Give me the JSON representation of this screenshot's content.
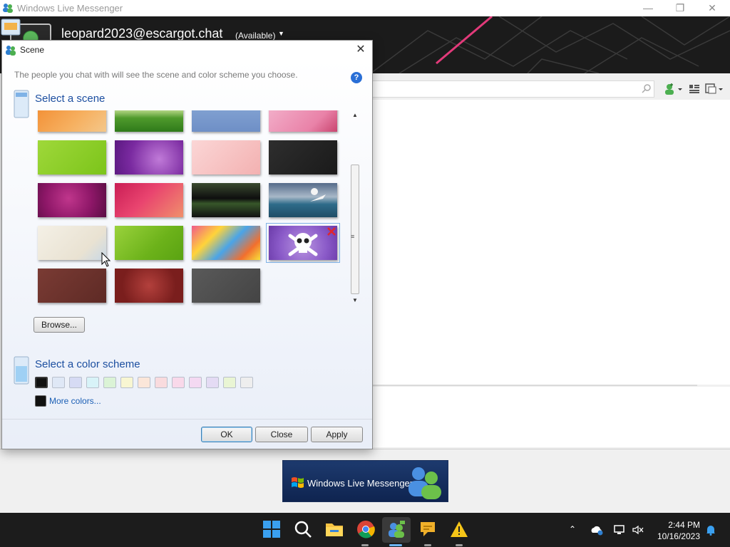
{
  "main_window": {
    "title": "Windows Live Messenger",
    "user_email": "leopard2023@escargot.chat",
    "status": "(Available)",
    "ad_text": "Windows Live Messenger"
  },
  "dialog": {
    "title": "Scene",
    "description": "The people you chat with will see the scene and color scheme you choose.",
    "help_label": "?",
    "scene_section_title": "Select a scene",
    "color_section_title": "Select a color scheme",
    "browse_label": "Browse...",
    "more_colors_label": "More colors...",
    "ok_label": "OK",
    "close_label": "Close",
    "apply_label": "Apply"
  },
  "scenes": [
    {
      "name": "orange-feathers",
      "bg": "linear-gradient(135deg,#f28a2e,#f6b060 60%,#f4c78a)"
    },
    {
      "name": "green-field",
      "bg": "linear-gradient(#cfe3b5 0%,#a9cf7a 40%,#4f9a2c 60%,#2f7a1a 100%)"
    },
    {
      "name": "blue-sky",
      "bg": "linear-gradient(#8aa9d6,#6e8fc6)"
    },
    {
      "name": "pink-floral",
      "bg": "linear-gradient(135deg,#f4b6cf,#e982a8 70%,#c9456f)"
    },
    {
      "name": "lime-green",
      "bg": "linear-gradient(135deg,#9fd83a,#7cc41a)"
    },
    {
      "name": "purple-swirls",
      "bg": "radial-gradient(circle at 65% 55%,#c07ad8,#7a2aa0 60%,#5a1880)"
    },
    {
      "name": "cherry-blossom",
      "bg": "linear-gradient(135deg,#fbd6d6,#f3b1b1)"
    },
    {
      "name": "dark-geometric",
      "bg": "linear-gradient(135deg,#2e2e2e,#1a1a1a)"
    },
    {
      "name": "magenta-flower",
      "bg": "radial-gradient(circle at 45% 45%,#c0368c,#8e1768 55%,#5a0d44)"
    },
    {
      "name": "pink-swirl",
      "bg": "linear-gradient(135deg,#c91d55,#e9446f 45%,#f0906c)"
    },
    {
      "name": "dark-waves",
      "bg": "linear-gradient(#3a4a30,#0e0e0e 45%,#37572a 60%,#111 100%)"
    },
    {
      "name": "ocean-plane",
      "bg": "linear-gradient(#556b8a,#a8b8c8 40%,#2e6b8a 62%,#1f4d66)"
    },
    {
      "name": "paper-bird",
      "bg": "linear-gradient(135deg,#f4f0e6,#e9e2d2 70%,#c8d8e6)"
    },
    {
      "name": "bamboo-green",
      "bg": "linear-gradient(135deg,#9ad23c,#6cb21a 60%,#5aa312)"
    },
    {
      "name": "colorful-blobs",
      "bg": "linear-gradient(135deg,#f05a8a,#ffd33a 30%,#4aa4e8 55%,#f26f2e 80%,#f7e23a)"
    },
    {
      "name": "skull-purple",
      "bg": "radial-gradient(circle at 50% 60%,#b894e0,#8a5ac8 60%,#6a3aa8)"
    },
    {
      "name": "brown-pattern",
      "bg": "linear-gradient(135deg,#7a3b34,#5e2a25)"
    },
    {
      "name": "love-heart",
      "bg": "radial-gradient(circle at 50% 50%,#b3403c,#7a1e1d 70%)"
    },
    {
      "name": "gray-hex",
      "bg": "linear-gradient(135deg,#5a5a5a,#444444)"
    }
  ],
  "color_swatches": [
    {
      "name": "black",
      "color": "#111111"
    },
    {
      "name": "light-blue",
      "color": "#dfe8f6"
    },
    {
      "name": "periwinkle",
      "color": "#d6dbf4"
    },
    {
      "name": "cyan",
      "color": "#d8f3f8"
    },
    {
      "name": "green",
      "color": "#dbf3d6"
    },
    {
      "name": "yellow",
      "color": "#f8f6d2"
    },
    {
      "name": "peach",
      "color": "#fbe6d9"
    },
    {
      "name": "salmon",
      "color": "#f9dbde"
    },
    {
      "name": "pink",
      "color": "#f9d9ea"
    },
    {
      "name": "magenta",
      "color": "#f4d9f2"
    },
    {
      "name": "lavender",
      "color": "#e4dbf4"
    },
    {
      "name": "lime",
      "color": "#e9f5d4"
    },
    {
      "name": "gray",
      "color": "#eeeeee"
    }
  ],
  "taskbar": {
    "time": "2:44 PM",
    "date": "10/16/2023"
  }
}
